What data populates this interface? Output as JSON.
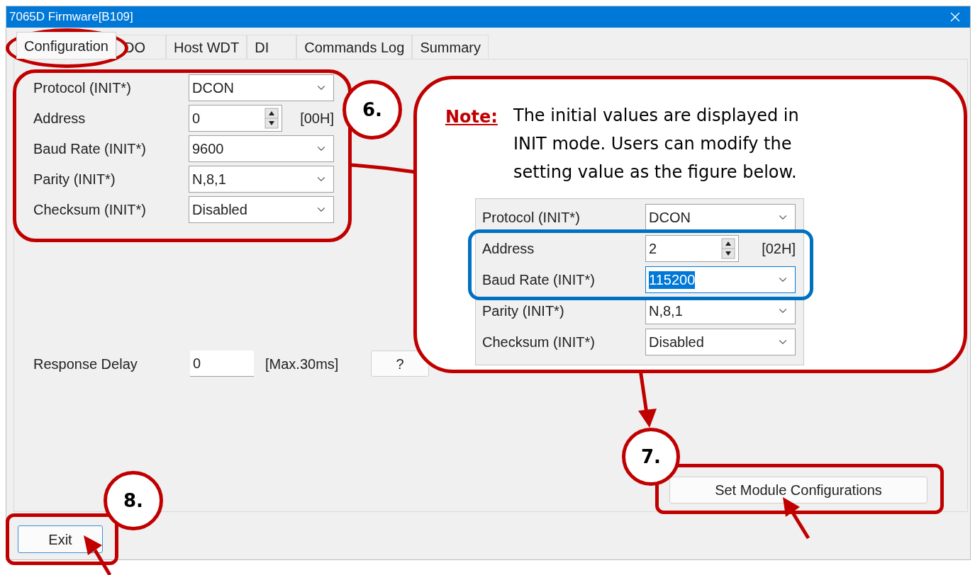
{
  "window": {
    "title": "7065D Firmware[B109]"
  },
  "tabs": [
    {
      "label": "Configuration",
      "selected": true
    },
    {
      "label": "DO",
      "selected": false
    },
    {
      "label": "Host WDT",
      "selected": false
    },
    {
      "label": "DI",
      "selected": false
    },
    {
      "label": "Commands Log",
      "selected": false
    },
    {
      "label": "Summary",
      "selected": false
    }
  ],
  "config_fields": [
    {
      "kind": "dropdown",
      "label": "Protocol (INIT*)",
      "value": "DCON"
    },
    {
      "kind": "spinner",
      "label": "Address",
      "value": "0",
      "suffix": "[00H]"
    },
    {
      "kind": "dropdown",
      "label": "Baud Rate (INIT*)",
      "value": "9600"
    },
    {
      "kind": "dropdown",
      "label": "Parity (INIT*)",
      "value": "N,8,1"
    },
    {
      "kind": "dropdown",
      "label": "Checksum (INIT*)",
      "value": "Disabled"
    }
  ],
  "response_delay": {
    "label": "Response Delay",
    "value": "0",
    "hint": "[Max.30ms]",
    "help_button": "?"
  },
  "set_button": "Set Module Configurations",
  "exit_button": "Exit",
  "annotations": {
    "steps": [
      {
        "label": "6."
      },
      {
        "label": "7."
      },
      {
        "label": "8."
      }
    ],
    "note": {
      "heading": "Note:",
      "text": "The initial values are displayed in INIT mode. Users can modify the setting value as the figure below.",
      "example_fields": [
        {
          "kind": "dropdown",
          "label": "Protocol (INIT*)",
          "value": "DCON",
          "text_selected": false
        },
        {
          "kind": "spinner",
          "label": "Address",
          "value": "2",
          "suffix": "[02H]",
          "text_selected": false
        },
        {
          "kind": "dropdown",
          "label": "Baud Rate (INIT*)",
          "value": "115200",
          "text_selected": true
        },
        {
          "kind": "dropdown",
          "label": "Parity (INIT*)",
          "value": "N,8,1",
          "text_selected": false
        },
        {
          "kind": "dropdown",
          "label": "Checksum (INIT*)",
          "value": "Disabled",
          "text_selected": false
        }
      ]
    }
  }
}
